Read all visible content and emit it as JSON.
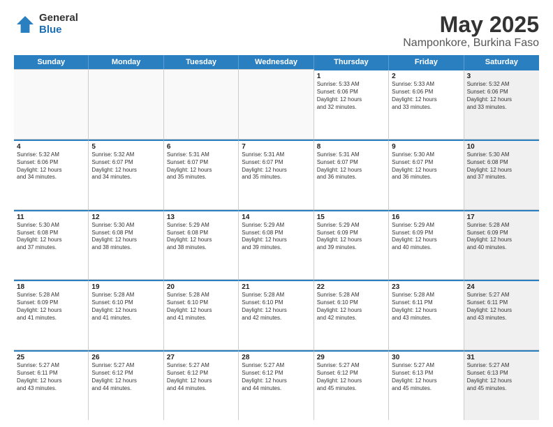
{
  "header": {
    "logo_general": "General",
    "logo_blue": "Blue",
    "title": "May 2025",
    "subtitle": "Namponkore, Burkina Faso"
  },
  "weekdays": [
    "Sunday",
    "Monday",
    "Tuesday",
    "Wednesday",
    "Thursday",
    "Friday",
    "Saturday"
  ],
  "rows": [
    [
      {
        "day": "",
        "info": "",
        "empty": true
      },
      {
        "day": "",
        "info": "",
        "empty": true
      },
      {
        "day": "",
        "info": "",
        "empty": true
      },
      {
        "day": "",
        "info": "",
        "empty": true
      },
      {
        "day": "1",
        "info": "Sunrise: 5:33 AM\nSunset: 6:06 PM\nDaylight: 12 hours\nand 32 minutes.",
        "empty": false
      },
      {
        "day": "2",
        "info": "Sunrise: 5:33 AM\nSunset: 6:06 PM\nDaylight: 12 hours\nand 33 minutes.",
        "empty": false
      },
      {
        "day": "3",
        "info": "Sunrise: 5:32 AM\nSunset: 6:06 PM\nDaylight: 12 hours\nand 33 minutes.",
        "empty": false,
        "shaded": true
      }
    ],
    [
      {
        "day": "4",
        "info": "Sunrise: 5:32 AM\nSunset: 6:06 PM\nDaylight: 12 hours\nand 34 minutes.",
        "empty": false
      },
      {
        "day": "5",
        "info": "Sunrise: 5:32 AM\nSunset: 6:07 PM\nDaylight: 12 hours\nand 34 minutes.",
        "empty": false
      },
      {
        "day": "6",
        "info": "Sunrise: 5:31 AM\nSunset: 6:07 PM\nDaylight: 12 hours\nand 35 minutes.",
        "empty": false
      },
      {
        "day": "7",
        "info": "Sunrise: 5:31 AM\nSunset: 6:07 PM\nDaylight: 12 hours\nand 35 minutes.",
        "empty": false
      },
      {
        "day": "8",
        "info": "Sunrise: 5:31 AM\nSunset: 6:07 PM\nDaylight: 12 hours\nand 36 minutes.",
        "empty": false
      },
      {
        "day": "9",
        "info": "Sunrise: 5:30 AM\nSunset: 6:07 PM\nDaylight: 12 hours\nand 36 minutes.",
        "empty": false
      },
      {
        "day": "10",
        "info": "Sunrise: 5:30 AM\nSunset: 6:08 PM\nDaylight: 12 hours\nand 37 minutes.",
        "empty": false,
        "shaded": true
      }
    ],
    [
      {
        "day": "11",
        "info": "Sunrise: 5:30 AM\nSunset: 6:08 PM\nDaylight: 12 hours\nand 37 minutes.",
        "empty": false
      },
      {
        "day": "12",
        "info": "Sunrise: 5:30 AM\nSunset: 6:08 PM\nDaylight: 12 hours\nand 38 minutes.",
        "empty": false
      },
      {
        "day": "13",
        "info": "Sunrise: 5:29 AM\nSunset: 6:08 PM\nDaylight: 12 hours\nand 38 minutes.",
        "empty": false
      },
      {
        "day": "14",
        "info": "Sunrise: 5:29 AM\nSunset: 6:08 PM\nDaylight: 12 hours\nand 39 minutes.",
        "empty": false
      },
      {
        "day": "15",
        "info": "Sunrise: 5:29 AM\nSunset: 6:09 PM\nDaylight: 12 hours\nand 39 minutes.",
        "empty": false
      },
      {
        "day": "16",
        "info": "Sunrise: 5:29 AM\nSunset: 6:09 PM\nDaylight: 12 hours\nand 40 minutes.",
        "empty": false
      },
      {
        "day": "17",
        "info": "Sunrise: 5:28 AM\nSunset: 6:09 PM\nDaylight: 12 hours\nand 40 minutes.",
        "empty": false,
        "shaded": true
      }
    ],
    [
      {
        "day": "18",
        "info": "Sunrise: 5:28 AM\nSunset: 6:09 PM\nDaylight: 12 hours\nand 41 minutes.",
        "empty": false
      },
      {
        "day": "19",
        "info": "Sunrise: 5:28 AM\nSunset: 6:10 PM\nDaylight: 12 hours\nand 41 minutes.",
        "empty": false
      },
      {
        "day": "20",
        "info": "Sunrise: 5:28 AM\nSunset: 6:10 PM\nDaylight: 12 hours\nand 41 minutes.",
        "empty": false
      },
      {
        "day": "21",
        "info": "Sunrise: 5:28 AM\nSunset: 6:10 PM\nDaylight: 12 hours\nand 42 minutes.",
        "empty": false
      },
      {
        "day": "22",
        "info": "Sunrise: 5:28 AM\nSunset: 6:10 PM\nDaylight: 12 hours\nand 42 minutes.",
        "empty": false
      },
      {
        "day": "23",
        "info": "Sunrise: 5:28 AM\nSunset: 6:11 PM\nDaylight: 12 hours\nand 43 minutes.",
        "empty": false
      },
      {
        "day": "24",
        "info": "Sunrise: 5:27 AM\nSunset: 6:11 PM\nDaylight: 12 hours\nand 43 minutes.",
        "empty": false,
        "shaded": true
      }
    ],
    [
      {
        "day": "25",
        "info": "Sunrise: 5:27 AM\nSunset: 6:11 PM\nDaylight: 12 hours\nand 43 minutes.",
        "empty": false
      },
      {
        "day": "26",
        "info": "Sunrise: 5:27 AM\nSunset: 6:12 PM\nDaylight: 12 hours\nand 44 minutes.",
        "empty": false
      },
      {
        "day": "27",
        "info": "Sunrise: 5:27 AM\nSunset: 6:12 PM\nDaylight: 12 hours\nand 44 minutes.",
        "empty": false
      },
      {
        "day": "28",
        "info": "Sunrise: 5:27 AM\nSunset: 6:12 PM\nDaylight: 12 hours\nand 44 minutes.",
        "empty": false
      },
      {
        "day": "29",
        "info": "Sunrise: 5:27 AM\nSunset: 6:12 PM\nDaylight: 12 hours\nand 45 minutes.",
        "empty": false
      },
      {
        "day": "30",
        "info": "Sunrise: 5:27 AM\nSunset: 6:13 PM\nDaylight: 12 hours\nand 45 minutes.",
        "empty": false
      },
      {
        "day": "31",
        "info": "Sunrise: 5:27 AM\nSunset: 6:13 PM\nDaylight: 12 hours\nand 45 minutes.",
        "empty": false,
        "shaded": true
      }
    ]
  ]
}
